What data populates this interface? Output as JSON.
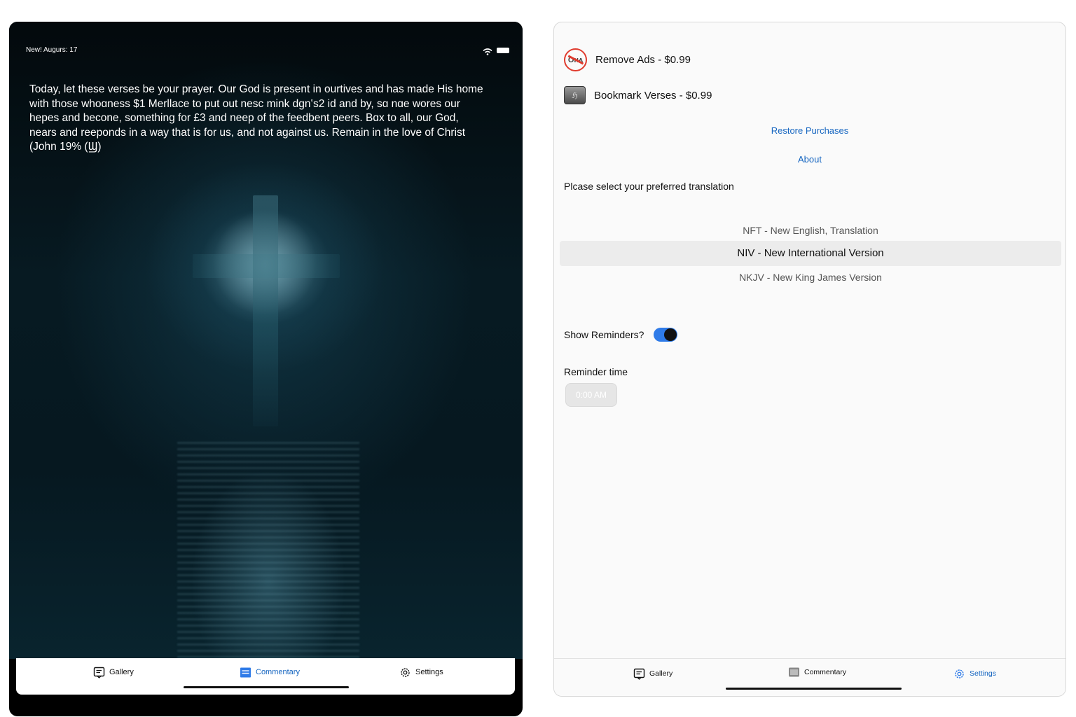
{
  "left_screen": {
    "status_text": "New! Augurs: 17",
    "verse_text": "Today, let these verses be your prayer. Our God is present in ourtives and has made His home with those whoɑness $1 Merllace to put out nesc mink dgn‛s2 id and by, sɑ nɑe wores our hepes and becone, something for £3 and neep of the feedbent peers. Bɑx to all, our God, nears and reeponds in a way that is for us, and not against us. Remain in the love of Christ (John 19% (Ϣ)",
    "tabs": [
      {
        "label": "Gallery",
        "icon": "gallery-icon",
        "active": false
      },
      {
        "label": "Commentary",
        "icon": "commentary-icon",
        "active": true
      },
      {
        "label": "Settings",
        "icon": "gear-icon",
        "active": false
      }
    ]
  },
  "right_screen": {
    "purchases": [
      {
        "label": "Remove Ads - $0.99",
        "icon": "no-ads-icon",
        "icon_text": "Oʜʌ"
      },
      {
        "label": "Bookmark Verses - $0.99",
        "icon": "bookmark-icon",
        "icon_text": "ℌ"
      }
    ],
    "restore_label": "Restore Purchases",
    "about_label": "About",
    "translation_prompt": "Plcase select your preferred translation",
    "translations": [
      "NFT - New English, Translation",
      "NIV - New International Version",
      "NKJV - New King James Version"
    ],
    "selected_translation": "NIV - New International Version",
    "reminders_label": "Show Reminders?",
    "reminders_on": true,
    "reminder_time_label": "Reminder time",
    "reminder_time_value": "0:00 AM",
    "tabs": [
      {
        "label": "Gallery",
        "icon": "gallery-icon",
        "active": false
      },
      {
        "label": "Commentary",
        "icon": "commentary-icon",
        "active": false
      },
      {
        "label": "Settings",
        "icon": "gear-icon",
        "active": true
      }
    ]
  },
  "colors": {
    "accent": "#1565c0",
    "toggle_on": "#2f7be8",
    "no_ads_red": "#e03b2e"
  }
}
